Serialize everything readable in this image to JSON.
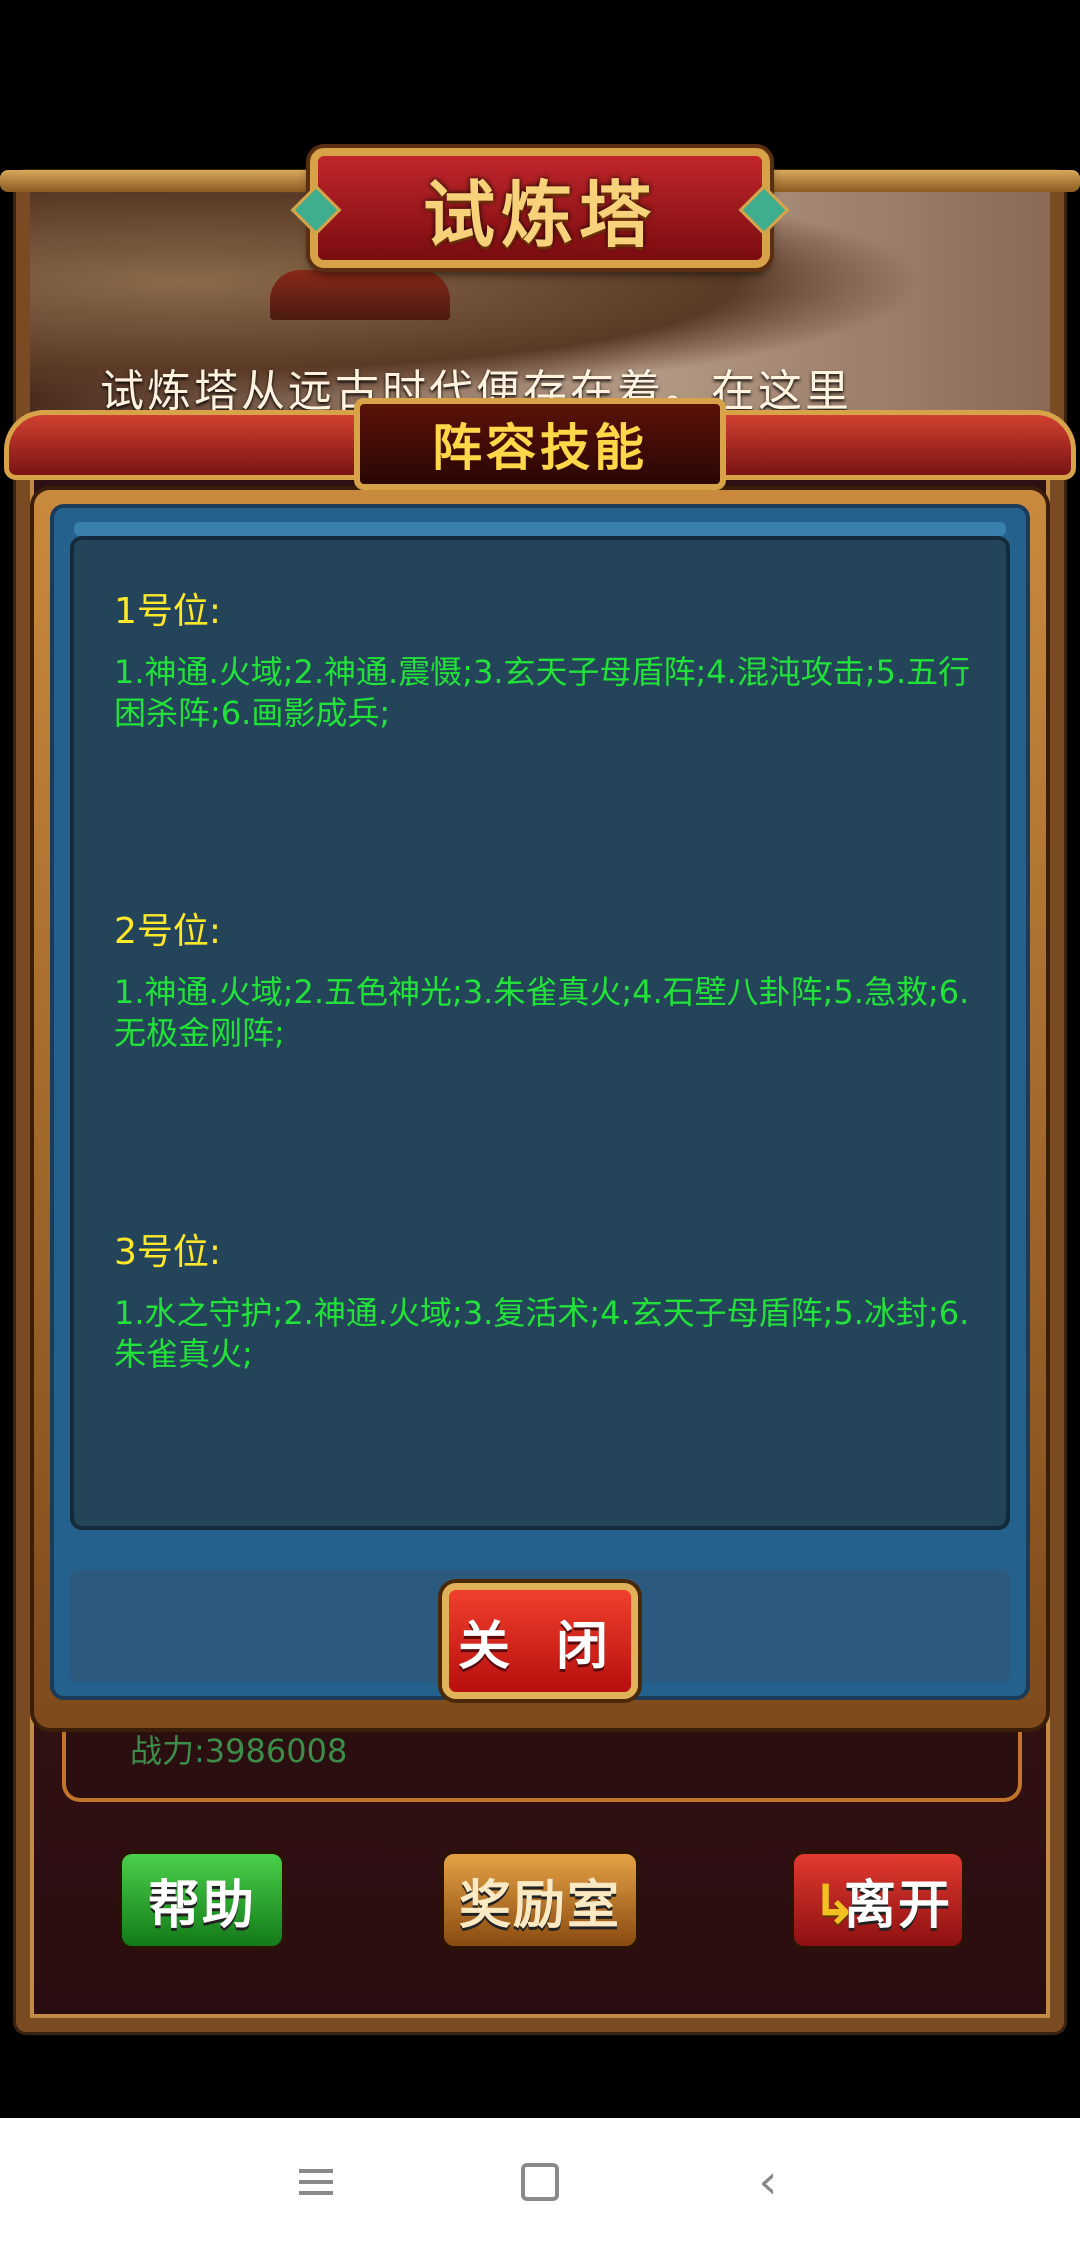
{
  "game": {
    "tower_title": "试炼塔",
    "intro_text": "试炼塔从远古时代便存在着。在这里",
    "power_text": "战力:3986008"
  },
  "modal": {
    "title": "阵容技能",
    "slots": [
      {
        "title": "1号位:",
        "skills": "1.神通.火域;2.神通.震慑;3.玄天子母盾阵;4.混沌攻击;5.五行困杀阵;6.画影成兵;"
      },
      {
        "title": "2号位:",
        "skills": "1.神通.火域;2.五色神光;3.朱雀真火;4.石壁八卦阵;5.急救;6.无极金刚阵;"
      },
      {
        "title": "3号位:",
        "skills": "1.水之守护;2.神通.火域;3.复活术;4.玄天子母盾阵;5.冰封;6.朱雀真火;"
      }
    ],
    "close_label": "关 闭"
  },
  "buttons": {
    "help": "帮助",
    "reward": "奖励室",
    "leave": "离开"
  },
  "colors": {
    "slot_title": "#ffe82a",
    "skill_text": "#22e23a",
    "panel_bg": "#244459"
  },
  "icons": {
    "nav_menu": "menu-icon",
    "nav_home": "home-icon",
    "nav_back": "back-icon",
    "leave_arrow": "turn-arrow-icon"
  }
}
